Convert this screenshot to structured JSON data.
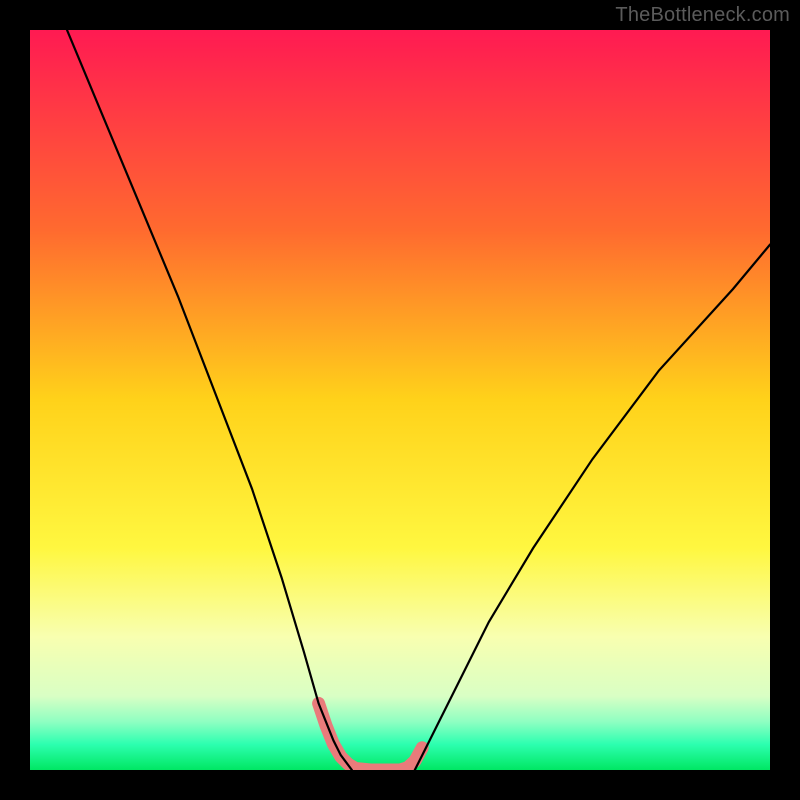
{
  "attribution": "TheBottleneck.com",
  "chart_data": {
    "type": "line",
    "title": "",
    "xlabel": "",
    "ylabel": "",
    "xlim": [
      0,
      100
    ],
    "ylim": [
      0,
      100
    ],
    "gradient_stops": [
      {
        "offset": 0,
        "color": "#ff1a52"
      },
      {
        "offset": 0.27,
        "color": "#ff6a2f"
      },
      {
        "offset": 0.5,
        "color": "#ffd21a"
      },
      {
        "offset": 0.7,
        "color": "#fff740"
      },
      {
        "offset": 0.82,
        "color": "#f8ffb0"
      },
      {
        "offset": 0.9,
        "color": "#d9ffc4"
      },
      {
        "offset": 0.935,
        "color": "#8effc2"
      },
      {
        "offset": 0.965,
        "color": "#2dffb0"
      },
      {
        "offset": 1.0,
        "color": "#00e763"
      }
    ],
    "series": [
      {
        "name": "left-curve",
        "x": [
          5,
          10,
          15,
          20,
          25,
          30,
          34,
          37,
          39,
          41,
          42,
          43.5
        ],
        "y": [
          100,
          88,
          76,
          64,
          51,
          38,
          26,
          16,
          9,
          4,
          2,
          0
        ]
      },
      {
        "name": "right-curve",
        "x": [
          52,
          53,
          55,
          58,
          62,
          68,
          76,
          85,
          95,
          100
        ],
        "y": [
          0,
          2,
          6,
          12,
          20,
          30,
          42,
          54,
          65,
          71
        ]
      },
      {
        "name": "valley-marker",
        "x": [
          39,
          40,
          41,
          42,
          43,
          44,
          46,
          48,
          50,
          51,
          52,
          53
        ],
        "y": [
          9,
          6,
          3.5,
          1.8,
          0.8,
          0.2,
          0,
          0,
          0,
          0.3,
          1.2,
          3
        ]
      }
    ],
    "marker_color": "#e97b7b",
    "curve_color": "#000000",
    "curve_width": 2.2,
    "marker_width": 13
  }
}
